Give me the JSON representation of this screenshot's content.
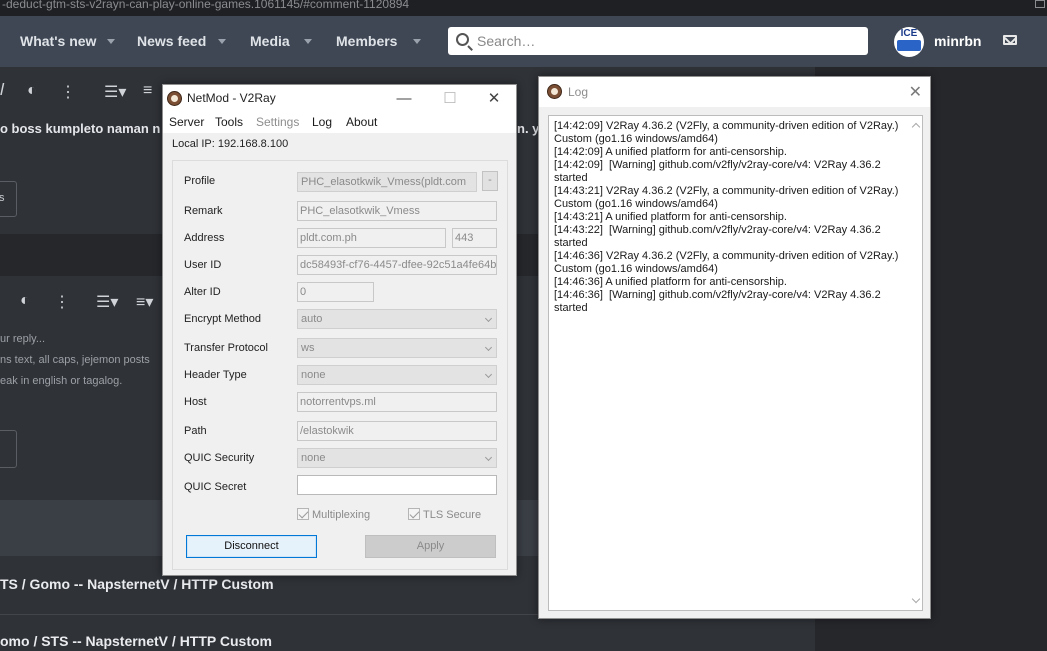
{
  "browser": {
    "url_fragment": "-deduct-gtm-sts-v2rayn-can-play-online-games.1061145/#comment-1120894"
  },
  "forum": {
    "nav": [
      {
        "label": "What's new"
      },
      {
        "label": "News feed"
      },
      {
        "label": "Media"
      },
      {
        "label": "Members"
      }
    ],
    "search_placeholder": "Search…",
    "avatar_text": "ICE",
    "username": "minrbn",
    "post_snippet": "o boss kumpleto naman n",
    "post_snippet_right": "n. ya",
    "left_btn_text": "s",
    "editor_hints": [
      "ur reply...",
      "ns text, all caps, jejemon posts",
      "eak in english or tagalog."
    ],
    "thread_titles": [
      "TS / Gomo -- NapsternetV / HTTP Custom",
      "omo / STS -- NapsternetV / HTTP Custom"
    ]
  },
  "netmod": {
    "title": "NetMod - V2Ray",
    "controls": {
      "minimize": "—",
      "maximize": "☐",
      "close": "✕"
    },
    "menu": [
      {
        "label": "Server",
        "enabled": true
      },
      {
        "label": "Tools",
        "enabled": true
      },
      {
        "label": "Settings",
        "enabled": false
      },
      {
        "label": "Log",
        "enabled": true
      },
      {
        "label": "About",
        "enabled": true
      }
    ],
    "local_ip": "Local IP:  192.168.8.100",
    "labels": {
      "profile": "Profile",
      "remark": "Remark",
      "address": "Address",
      "user_id": "User ID",
      "alter_id": "Alter ID",
      "encrypt_method": "Encrypt Method",
      "transfer_protocol": "Transfer Protocol",
      "header_type": "Header Type",
      "host": "Host",
      "path": "Path",
      "quic_security": "QUIC Security",
      "quic_secret": "QUIC Secret"
    },
    "values": {
      "profile": "PHC_elasotkwik_Vmess(pldt.com",
      "profile_btn": "-",
      "remark": "PHC_elasotkwik_Vmess",
      "address": "pldt.com.ph",
      "port": "443",
      "user_id": "dc58493f-cf76-4457-dfee-92c51a4fe64b",
      "alter_id": "0",
      "encrypt_method": "auto",
      "transfer_protocol": "ws",
      "header_type": "none",
      "host": "notorrentvps.ml",
      "path": "/elastokwik",
      "quic_security": "none",
      "quic_secret": ""
    },
    "multiplexing_label": "Multiplexing",
    "tls_label": "TLS Secure",
    "disconnect_label": "Disconnect",
    "apply_label": "Apply"
  },
  "log": {
    "title": "Log",
    "close": "✕",
    "lines": [
      "[14:42:09] V2Ray 4.36.2 (V2Fly, a community-driven edition of V2Ray.) Custom (go1.16 windows/amd64)",
      "[14:42:09] A unified platform for anti-censorship.",
      "[14:42:09]  [Warning] github.com/v2fly/v2ray-core/v4: V2Ray 4.36.2 started",
      "[14:43:21] V2Ray 4.36.2 (V2Fly, a community-driven edition of V2Ray.) Custom (go1.16 windows/amd64)",
      "[14:43:21] A unified platform for anti-censorship.",
      "[14:43:22]  [Warning] github.com/v2fly/v2ray-core/v4: V2Ray 4.36.2 started",
      "[14:46:36] V2Ray 4.36.2 (V2Fly, a community-driven edition of V2Ray.) Custom (go1.16 windows/amd64)",
      "[14:46:36] A unified platform for anti-censorship.",
      "[14:46:36]  [Warning] github.com/v2fly/v2ray-core/v4: V2Ray 4.36.2 started"
    ]
  }
}
